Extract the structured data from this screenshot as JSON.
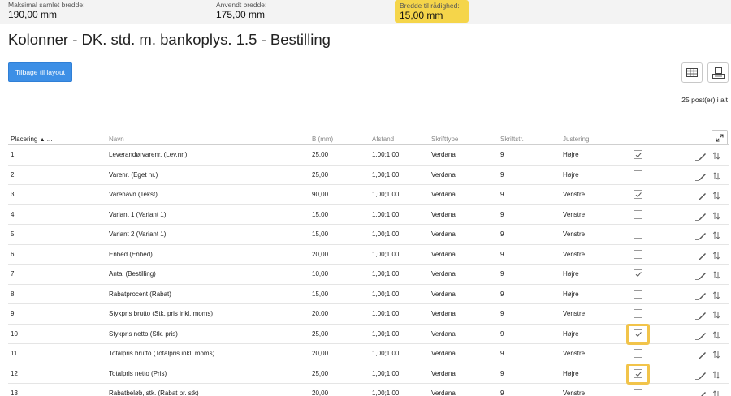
{
  "stats": {
    "max_width_label": "Maksimal samlet bredde:",
    "max_width_value": "190,00 mm",
    "used_width_label": "Anvendt bredde:",
    "used_width_value": "175,00 mm",
    "available_width_label": "Bredde til rådighed:",
    "available_width_value": "15,00 mm"
  },
  "page_title": "Kolonner - DK. std. m. bankoplys. 1.5 - Bestilling",
  "back_button": "Tilbage til layout",
  "record_count": "25 post(er) i alt",
  "columns": {
    "placering": "Placering",
    "placering_sort": "▲",
    "placering_more": "...",
    "navn": "Navn",
    "b_mm": "B (mm)",
    "afstand": "Afstand",
    "skrifttype": "Skrifttype",
    "skriftstr": "Skriftstr.",
    "justering": "Justering"
  },
  "rows": [
    {
      "pos": "1",
      "name": "Leverandørvarenr. (Lev.nr.)",
      "b": "25,00",
      "afstand": "1,00;1,00",
      "font": "Verdana",
      "size": "9",
      "just": "Højre",
      "checked": true
    },
    {
      "pos": "2",
      "name": "Varenr. (Eget nr.)",
      "b": "25,00",
      "afstand": "1,00;1,00",
      "font": "Verdana",
      "size": "9",
      "just": "Højre",
      "checked": false
    },
    {
      "pos": "3",
      "name": "Varenavn (Tekst)",
      "b": "90,00",
      "afstand": "1,00;1,00",
      "font": "Verdana",
      "size": "9",
      "just": "Venstre",
      "checked": true
    },
    {
      "pos": "4",
      "name": "Variant 1 (Variant 1)",
      "b": "15,00",
      "afstand": "1,00;1,00",
      "font": "Verdana",
      "size": "9",
      "just": "Venstre",
      "checked": false
    },
    {
      "pos": "5",
      "name": "Variant 2 (Variant 1)",
      "b": "15,00",
      "afstand": "1,00;1,00",
      "font": "Verdana",
      "size": "9",
      "just": "Venstre",
      "checked": false
    },
    {
      "pos": "6",
      "name": "Enhed (Enhed)",
      "b": "20,00",
      "afstand": "1,00;1,00",
      "font": "Verdana",
      "size": "9",
      "just": "Venstre",
      "checked": false
    },
    {
      "pos": "7",
      "name": "Antal (Bestilling)",
      "b": "10,00",
      "afstand": "1,00;1,00",
      "font": "Verdana",
      "size": "9",
      "just": "Højre",
      "checked": true
    },
    {
      "pos": "8",
      "name": "Rabatprocent (Rabat)",
      "b": "15,00",
      "afstand": "1,00;1,00",
      "font": "Verdana",
      "size": "9",
      "just": "Højre",
      "checked": false
    },
    {
      "pos": "9",
      "name": "Stykpris brutto (Stk. pris inkl. moms)",
      "b": "20,00",
      "afstand": "1,00;1,00",
      "font": "Verdana",
      "size": "9",
      "just": "Venstre",
      "checked": false
    },
    {
      "pos": "10",
      "name": "Stykpris netto (Stk. pris)",
      "b": "25,00",
      "afstand": "1,00;1,00",
      "font": "Verdana",
      "size": "9",
      "just": "Højre",
      "checked": true,
      "highlight": true
    },
    {
      "pos": "11",
      "name": "Totalpris brutto (Totalpris inkl. moms)",
      "b": "20,00",
      "afstand": "1,00;1,00",
      "font": "Verdana",
      "size": "9",
      "just": "Venstre",
      "checked": false
    },
    {
      "pos": "12",
      "name": "Totalpris netto (Pris)",
      "b": "25,00",
      "afstand": "1,00;1,00",
      "font": "Verdana",
      "size": "9",
      "just": "Højre",
      "checked": true,
      "highlight": true
    },
    {
      "pos": "13",
      "name": "Rabatbeløb, stk. (Rabat pr. stk)",
      "b": "20,00",
      "afstand": "1,00;1,00",
      "font": "Verdana",
      "size": "9",
      "just": "Venstre",
      "checked": false
    }
  ],
  "icons": {
    "table_view": "table-icon",
    "print": "print-icon",
    "expand": "expand-icon",
    "edit": "pencil-icon",
    "move": "reorder-arrows-icon"
  },
  "colors": {
    "primary_button": "#3d8fe6",
    "highlight": "#f5d54a",
    "highlight_border": "#f2c44a"
  }
}
